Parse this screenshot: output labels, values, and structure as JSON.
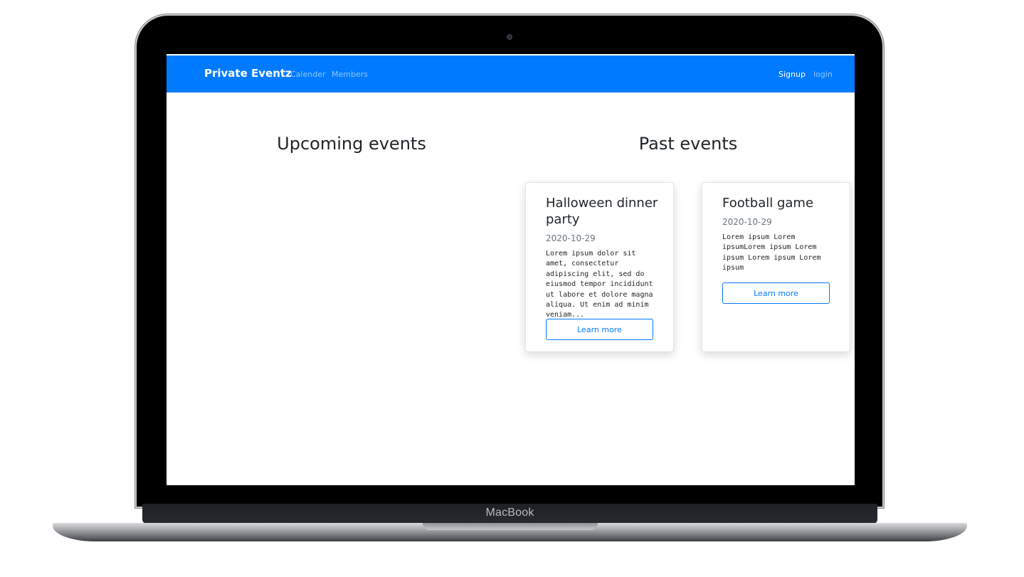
{
  "device": {
    "label": "MacBook"
  },
  "navbar": {
    "brand": "Private Eventz",
    "links": [
      {
        "label": "Calender"
      },
      {
        "label": "Members"
      }
    ],
    "auth": {
      "signup": "Signup",
      "login": "login"
    },
    "color": "#007bff"
  },
  "upcoming": {
    "title": "Upcoming events"
  },
  "past": {
    "title": "Past events",
    "cards": [
      {
        "title": "Halloween dinner party",
        "date": "2020-10-29",
        "description": "Lorem ipsum dolor sit amet, consectetur adipiscing elit, sed do eiusmod tempor incididunt ut labore et dolore magna aliqua. Ut enim ad minim veniam...",
        "button": "Learn more"
      },
      {
        "title": "Football game",
        "date": "2020-10-29",
        "description": "Lorem ipsum Lorem ipsumLorem ipsum Lorem ipsum Lorem ipsum Lorem ipsum",
        "button": "Learn more"
      }
    ]
  }
}
